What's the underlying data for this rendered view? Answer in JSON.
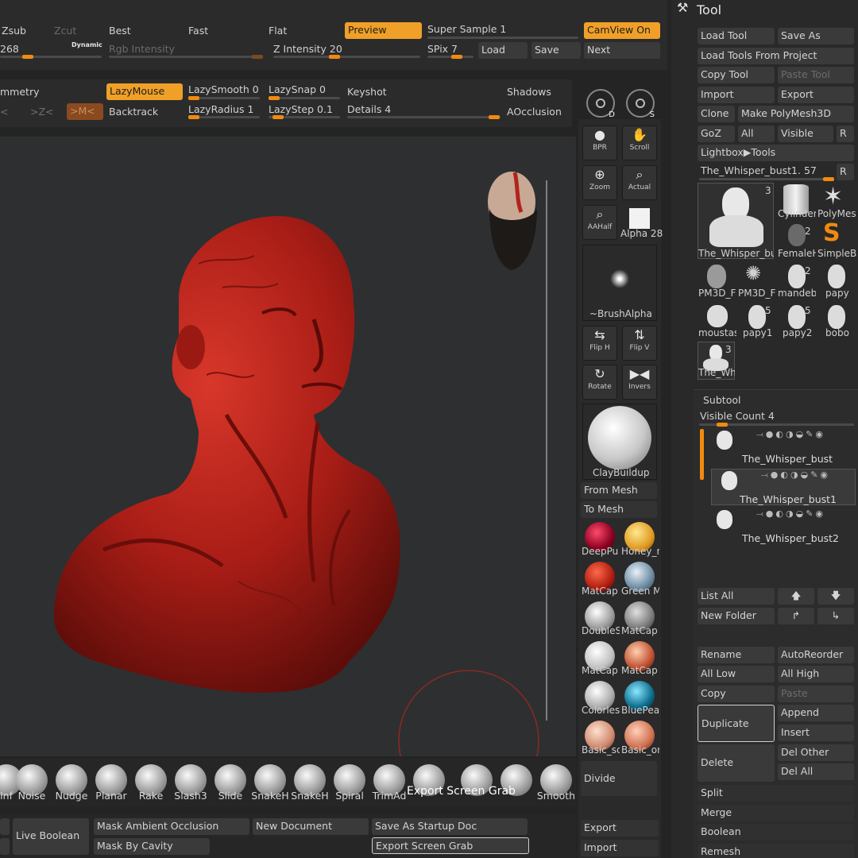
{
  "top_row1": {
    "zsub": "Zsub",
    "zcut": "Zcut",
    "best": "Best",
    "fast": "Fast",
    "flat": "Flat",
    "preview": "Preview",
    "super_sample": "Super Sample 1",
    "camview": "CamView On"
  },
  "top_row2": {
    "value_268": "268",
    "dynamic": "Dynamic",
    "rgb_intensity": "Rgb Intensity",
    "z_intensity": "Z Intensity 20",
    "spix": "SPix 7",
    "load": "Load",
    "save": "Save",
    "next": "Next"
  },
  "top_row3": {
    "symmetry": "mmetry",
    "lazymouse": "LazyMouse",
    "lazysmooth": "LazySmooth 0",
    "lazysnap": "LazySnap 0",
    "keyshot": "Keyshot",
    "shadows": "Shadows"
  },
  "top_row4": {
    "x_axis": "<",
    "z_axis": ">Z<",
    "m_axis": ">M<",
    "backtrack": "Backtrack",
    "lazyradius": "LazyRadius 1",
    "lazystep": "LazyStep 0.1",
    "details": "Details 4",
    "aocclusion": "AOcclusion"
  },
  "shelf": {
    "bpr": "BPR",
    "scroll": "Scroll",
    "zoom": "Zoom",
    "actual": "Actual",
    "aahalf": "AAHalf",
    "alpha": "Alpha 28",
    "brushalpha": "~BrushAlpha",
    "fliph": "Flip H",
    "flipv": "Flip V",
    "rotate": "Rotate",
    "invers": "Invers",
    "claybuildup": "ClayBuildup",
    "from_mesh": "From Mesh",
    "to_mesh": "To Mesh",
    "divide": "Divide",
    "export": "Export",
    "import": "Import",
    "cam_d": "D",
    "cam_s": "S",
    "materials": [
      "DeepPu",
      "Honey_r",
      "MatCap",
      "Green M",
      "DoubleS",
      "MatCap",
      "MatCap",
      "MatCap",
      "Colorles",
      "BluePea",
      "Basic_sc",
      "Basic_or"
    ]
  },
  "tool": {
    "title": "Tool",
    "load_tool": "Load Tool",
    "save_as": "Save As",
    "load_from_project": "Load Tools From Project",
    "copy_tool": "Copy Tool",
    "paste_tool": "Paste Tool",
    "import": "Import",
    "export": "Export",
    "clone": "Clone",
    "make_polymesh": "Make PolyMesh3D",
    "goz": "GoZ",
    "all": "All",
    "visible": "Visible",
    "r": "R",
    "lightbox_tools": "Lightbox▶Tools",
    "current_tool": "The_Whisper_bust1. 57",
    "thumbs": {
      "main": "The_Whisper_bus",
      "main_count": "3",
      "cylinder": "Cylinder",
      "polymesh": "PolyMes",
      "femaleh": "FemaleH",
      "femaleh_count": "2",
      "simpleb": "SimpleB",
      "pm3d_f1": "PM3D_F",
      "pm3d_f2": "PM3D_F",
      "mandeb": "mandeb",
      "mandeb_count": "2",
      "papy": "papy",
      "moustas": "moustas",
      "papy1": "papy1",
      "papy1_count": "5",
      "papy2": "papy2",
      "papy2_count": "5",
      "bobo": "bobo",
      "the_wh": "The_Wh",
      "the_wh_count": "3"
    }
  },
  "subtool": {
    "title": "Subtool",
    "visible_count": "Visible Count 4",
    "items": [
      "The_Whisper_bust",
      "The_Whisper_bust1",
      "The_Whisper_bust2"
    ],
    "list_all": "List All",
    "new_folder": "New Folder",
    "rename": "Rename",
    "autoreorder": "AutoReorder",
    "all_low": "All Low",
    "all_high": "All High",
    "copy": "Copy",
    "paste": "Paste",
    "duplicate": "Duplicate",
    "append": "Append",
    "insert": "Insert",
    "delete": "Delete",
    "del_other": "Del Other",
    "del_all": "Del All",
    "split": "Split",
    "merge": "Merge",
    "boolean": "Boolean",
    "remesh": "Remesh"
  },
  "brushes": [
    "Inf",
    "Noise",
    "Nudge",
    "Planar",
    "Rake",
    "Slash3",
    "Slide",
    "SnakeH",
    "SnakeH",
    "Spiral",
    "TrimAd",
    "",
    "",
    "",
    "Smooth"
  ],
  "bottom": {
    "export_overlay": "Export Screen Grab",
    "live_boolean": "Live Boolean",
    "mask_ao": "Mask Ambient Occlusion",
    "mask_cavity": "Mask By Cavity",
    "new_document": "New Document",
    "save_startup": "Save As Startup Doc",
    "export_grab": "Export Screen Grab"
  },
  "colors": {
    "accent": "#f0a028",
    "sculpt": "#b8241c",
    "panel": "#292929"
  }
}
